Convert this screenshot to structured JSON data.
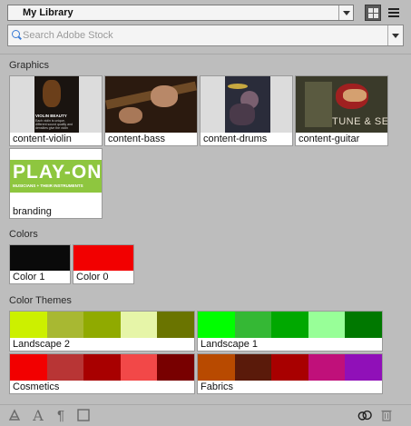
{
  "library": {
    "selected": "My Library"
  },
  "search": {
    "placeholder": "Search Adobe Stock"
  },
  "sections": {
    "graphics": "Graphics",
    "colors": "Colors",
    "themes": "Color Themes"
  },
  "graphics": [
    {
      "label": "content-violin",
      "thumb_texts": [
        "VIOLIN BEAUTY",
        "Each violin is unique, different sound quality and densities give the violin"
      ]
    },
    {
      "label": "content-bass"
    },
    {
      "label": "content-drums"
    },
    {
      "label": "content-guitar",
      "thumb_texts": [
        "TUNE & SETUP"
      ]
    },
    {
      "label": "branding",
      "thumb_texts": [
        "PLAY-ON",
        "MUSICIANS + THEIR INSTRUMENTS"
      ]
    }
  ],
  "colors": [
    {
      "label": "Color 1",
      "hex": "#0a0a0a"
    },
    {
      "label": "Color 0",
      "hex": "#f20000"
    }
  ],
  "themes": [
    {
      "label": "Landscape 2",
      "colors": [
        "#ccf000",
        "#a8b832",
        "#90aa00",
        "#e6f5a8",
        "#6a7400"
      ]
    },
    {
      "label": "Landscape 1",
      "colors": [
        "#00ff00",
        "#35b835",
        "#00a800",
        "#98ff98",
        "#007800"
      ]
    },
    {
      "label": "Cosmetics",
      "colors": [
        "#f20000",
        "#b83535",
        "#a80000",
        "#f24848",
        "#780000"
      ]
    },
    {
      "label": "Fabrics",
      "colors": [
        "#b84a00",
        "#5a1a0a",
        "#a80000",
        "#c0107a",
        "#9010b8"
      ]
    }
  ],
  "icons": [
    "graphic-style-icon",
    "text-icon",
    "paragraph-icon",
    "square-icon",
    "creative-cloud-sync-icon",
    "trash-icon"
  ]
}
